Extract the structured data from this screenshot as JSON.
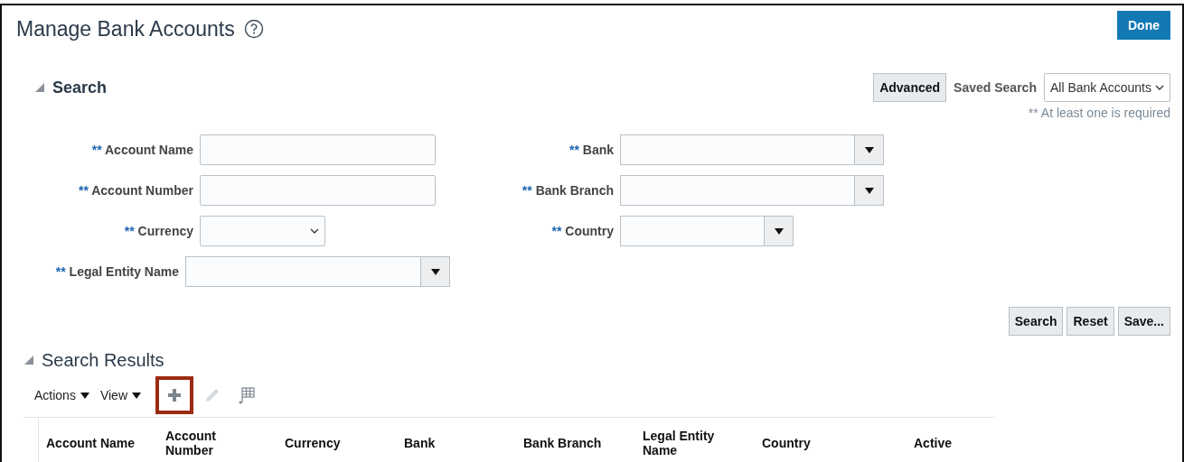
{
  "page": {
    "title": "Manage Bank Accounts",
    "done_button": "Done"
  },
  "search": {
    "title": "Search",
    "expanded": true,
    "advanced_button": "Advanced",
    "saved_search_label": "Saved Search",
    "saved_search_value": "All Bank Accounts",
    "required_note": "** At least one is required",
    "columns": [
      [
        {
          "marker": "**",
          "label": "Account Name",
          "kind": "text"
        },
        {
          "marker": "**",
          "label": "Account Number",
          "kind": "text"
        },
        {
          "marker": "**",
          "label": "Currency",
          "kind": "select"
        },
        {
          "marker": "**",
          "label": "Legal Entity Name",
          "kind": "lov"
        }
      ],
      [
        {
          "marker": "**",
          "label": "Bank",
          "kind": "lov"
        },
        {
          "marker": "**",
          "label": "Bank Branch",
          "kind": "lov"
        },
        {
          "marker": "**",
          "label": "Country",
          "kind": "lov-short"
        }
      ]
    ],
    "buttons": [
      "Search",
      "Reset",
      "Save..."
    ]
  },
  "results": {
    "title": "Search Results",
    "expanded": true,
    "menus": [
      "Actions",
      "View"
    ],
    "tools": [
      {
        "kind": "add",
        "highlighted": true,
        "disabled": false
      },
      {
        "kind": "edit",
        "highlighted": false,
        "disabled": true
      },
      {
        "kind": "detach",
        "highlighted": false,
        "disabled": false
      }
    ],
    "columns": [
      "Account Name",
      "Account Number",
      "Currency",
      "Bank",
      "Bank Branch",
      "Legal Entity Name",
      "Country",
      "Active"
    ]
  }
}
